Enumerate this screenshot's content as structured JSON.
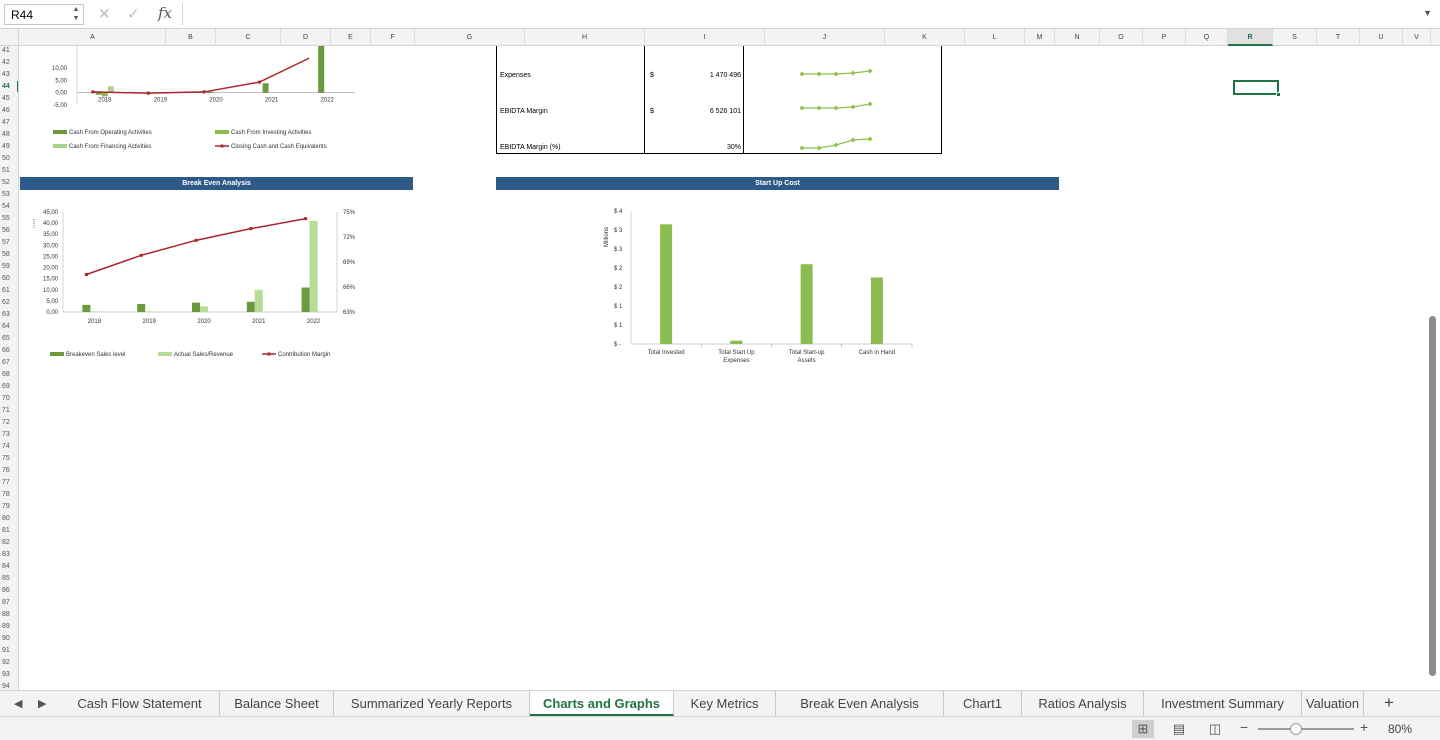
{
  "name_box": "R44",
  "formula_icons": {
    "cancel": "✕",
    "enter": "✓",
    "fx": "fx"
  },
  "columns": [
    "A",
    "B",
    "C",
    "D",
    "E",
    "F",
    "G",
    "H",
    "I",
    "J",
    "K",
    "L",
    "M",
    "N",
    "O",
    "P",
    "Q",
    "R",
    "S",
    "T",
    "U",
    "V"
  ],
  "active_column": "R",
  "rows": [
    41,
    42,
    43,
    44,
    45,
    46,
    47,
    48,
    49,
    50,
    51,
    52,
    53,
    54,
    55,
    56,
    57,
    58,
    59,
    60,
    61,
    62,
    63,
    64,
    65,
    66,
    67,
    68,
    69,
    70,
    71,
    72,
    73,
    74,
    75,
    76,
    77,
    78,
    79,
    80,
    81,
    82,
    83,
    84,
    85,
    86,
    87,
    88,
    89,
    90,
    91,
    92,
    93,
    94
  ],
  "active_row": 44,
  "kpi_table": {
    "rows": [
      {
        "label": "Expenses",
        "currency": "$",
        "value": "1 470 496"
      },
      {
        "label": "EBIDTA Margin",
        "currency": "$",
        "value": "6 526 101"
      },
      {
        "label": "EBIDTA Margin (%)",
        "currency": "",
        "value": "30%"
      }
    ]
  },
  "sections": {
    "break_even_title": "Break Even Analysis",
    "startup_title": "Start Up Cost"
  },
  "chart_data": [
    {
      "type": "bar",
      "categories": [
        "2018",
        "2019",
        "2020",
        "2021",
        "2022"
      ],
      "ylim": [
        -5,
        10
      ],
      "y_ticks": [
        "10,00",
        "5,00",
        "0,00",
        "-5,00"
      ],
      "series": [
        {
          "name": "Cash From Operating Activities",
          "kind": "bar",
          "color": "#6b9a3c",
          "values": [
            -0.8,
            0.1,
            0.4,
            3.8,
            40
          ]
        },
        {
          "name": "Cash From Investing Activities",
          "kind": "bar",
          "color": "#8bbd4e",
          "values": [
            -1.5,
            0,
            0,
            0,
            0
          ]
        },
        {
          "name": "Cash From Financing Activities",
          "kind": "bar",
          "color": "#a9d18e",
          "values": [
            2.6,
            0,
            0,
            0,
            0
          ]
        },
        {
          "name": "Closing Cash and Cash Equivalents",
          "kind": "line",
          "color": "#a8262d",
          "values": [
            0.3,
            -0.2,
            0.3,
            4.3,
            14
          ]
        }
      ]
    },
    {
      "type": "bar",
      "categories": [
        "2018",
        "2019",
        "2020",
        "2021",
        "2022"
      ],
      "ylim": [
        0,
        45
      ],
      "y_ticks": [
        "45,00",
        "40,00",
        "35,00",
        "30,00",
        "25,00",
        "20,00",
        "15,00",
        "10,00",
        "5,00",
        "0,00"
      ],
      "y2_ticks": [
        "75%",
        "72%",
        "69%",
        "66%",
        "63%"
      ],
      "y2lim": [
        63,
        75
      ],
      "series": [
        {
          "name": "Breakeven Sales level",
          "kind": "bar",
          "color": "#6b9a3c",
          "values": [
            3.2,
            3.6,
            4.2,
            4.6,
            11
          ]
        },
        {
          "name": "Actual Sales/Revenue",
          "kind": "bar",
          "color": "#b6dc97",
          "values": [
            0.3,
            0.3,
            2.5,
            10,
            41
          ]
        },
        {
          "name": "Contribution Margin",
          "kind": "line",
          "axis": "y2",
          "color": "#a8262d",
          "values": [
            67.5,
            69.8,
            71.6,
            73.0,
            74.2
          ]
        }
      ]
    },
    {
      "type": "bar",
      "categories": [
        "Total Invested",
        "Total Start Up Expenses",
        "Total Start-up Assets",
        "Cash in Hand"
      ],
      "ylabel": "Millions",
      "ylim": [
        0,
        4
      ],
      "y_ticks": [
        "$ 4",
        "$ 3",
        "$ 3",
        "$ 2",
        "$ 2",
        "$ 1",
        "$ 1",
        "$ -"
      ],
      "series": [
        {
          "name": "Start Up Cost",
          "color": "#8bbd4e",
          "values": [
            3.6,
            0.1,
            2.4,
            2.0
          ]
        }
      ]
    }
  ],
  "sheet_tabs": [
    "Cash Flow Statement",
    "Balance Sheet",
    "Summarized Yearly Reports",
    "Charts and Graphs",
    "Key Metrics",
    "Break Even Analysis",
    "Chart1",
    "Ratios Analysis",
    "Investment Summary",
    "Valuation"
  ],
  "active_tab": "Charts and Graphs",
  "zoom": "80%"
}
